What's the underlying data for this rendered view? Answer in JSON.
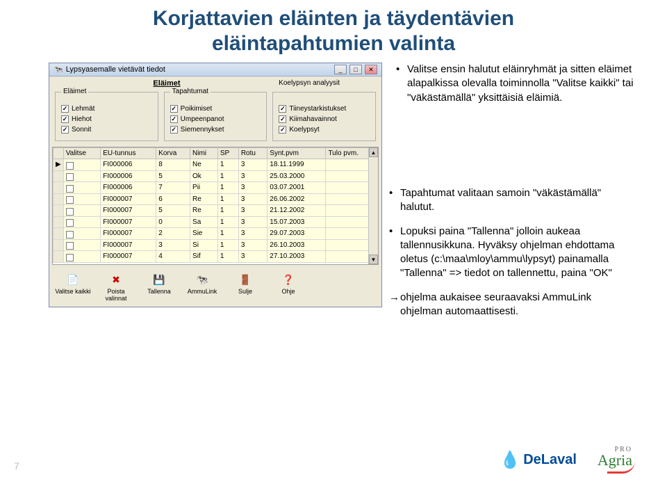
{
  "title_line1": "Korjattavien eläinten ja täydentävien",
  "title_line2": "eläintapahtumien valinta",
  "window": {
    "title": "Lypsyasemalle vietävät tiedot",
    "section_left": "Eläimet",
    "section_right": "Koelypsyn analyysit",
    "groups": {
      "elaimet": {
        "title": "Eläimet",
        "items": [
          "Lehmät",
          "Hiehot",
          "Sonnit"
        ]
      },
      "tapahtumat": {
        "title": "Tapahtumat",
        "items": [
          "Poikimiset",
          "Umpeenpanot",
          "Siemennykset"
        ]
      },
      "g3": {
        "title": "",
        "items": [
          "Tiineystarkistukset",
          "Kiimahavainnot",
          "Koelypsyt"
        ]
      }
    },
    "columns": [
      "Valitse",
      "EU-tunnus",
      "Korva",
      "Nimi",
      "SP",
      "Rotu",
      "Synt.pvm",
      "Tulo pvm."
    ],
    "rows": [
      {
        "sel": "",
        "eu": "FI000006",
        "korva": "8",
        "nimi": "Ne",
        "sp": "1",
        "rotu": "3",
        "synt": "18.11.1999",
        "tulo": ""
      },
      {
        "sel": "",
        "eu": "FI000006",
        "korva": "5",
        "nimi": "Ok",
        "sp": "1",
        "rotu": "3",
        "synt": "25.03.2000",
        "tulo": ""
      },
      {
        "sel": "",
        "eu": "FI000006",
        "korva": "7",
        "nimi": "Pii",
        "sp": "1",
        "rotu": "3",
        "synt": "03.07.2001",
        "tulo": ""
      },
      {
        "sel": "",
        "eu": "FI000007",
        "korva": "6",
        "nimi": "Re",
        "sp": "1",
        "rotu": "3",
        "synt": "26.06.2002",
        "tulo": ""
      },
      {
        "sel": "",
        "eu": "FI000007",
        "korva": "5",
        "nimi": "Re",
        "sp": "1",
        "rotu": "3",
        "synt": "21.12.2002",
        "tulo": ""
      },
      {
        "sel": "",
        "eu": "FI000007",
        "korva": "0",
        "nimi": "Sa",
        "sp": "1",
        "rotu": "3",
        "synt": "15.07.2003",
        "tulo": ""
      },
      {
        "sel": "",
        "eu": "FI000007",
        "korva": "2",
        "nimi": "Sie",
        "sp": "1",
        "rotu": "3",
        "synt": "29.07.2003",
        "tulo": ""
      },
      {
        "sel": "",
        "eu": "FI000007",
        "korva": "3",
        "nimi": "Si",
        "sp": "1",
        "rotu": "3",
        "synt": "26.10.2003",
        "tulo": ""
      },
      {
        "sel": "",
        "eu": "FI000007",
        "korva": "4",
        "nimi": "Sif",
        "sp": "1",
        "rotu": "3",
        "synt": "27.10.2003",
        "tulo": ""
      }
    ],
    "toolbar": [
      {
        "icon": "📄",
        "label": "Valitse kaikki"
      },
      {
        "icon": "✖",
        "label": "Poista valinnat",
        "color": "#c00"
      },
      {
        "icon": "💾",
        "label": "Tallenna"
      },
      {
        "icon": "🐄",
        "label": "AmmuLink"
      },
      {
        "icon": "🚪",
        "label": "Sulje"
      },
      {
        "icon": "❓",
        "label": "Ohje",
        "color": "#06c"
      }
    ]
  },
  "bullets_top": [
    "Valitse ensin halutut eläinryhmät ja sitten eläimet alapalkissa olevalla toiminnolla \"Valitse kaikki\" tai \"väkästämällä\" yksittäisiä eläimiä."
  ],
  "bullets_bottom": [
    "Tapahtumat valitaan samoin \"väkästämällä\" halutut.",
    "Lopuksi paina \"Tallenna\" jolloin aukeaa tallennusikkuna. Hyväksy ohjelman ehdottama oletus (c:\\maa\\mloy\\ammu\\lypsyt) painamalla \"Tallenna\" => tiedot on tallennettu, paina \"OK\""
  ],
  "bullet_arrow": "ohjelma aukaisee seuraavaksi AmmuLink ohjelman automaattisesti.",
  "footer": {
    "delaval": "DeLaval",
    "agria_pro": "PRO",
    "agria": "Agria"
  },
  "page_number": "7"
}
